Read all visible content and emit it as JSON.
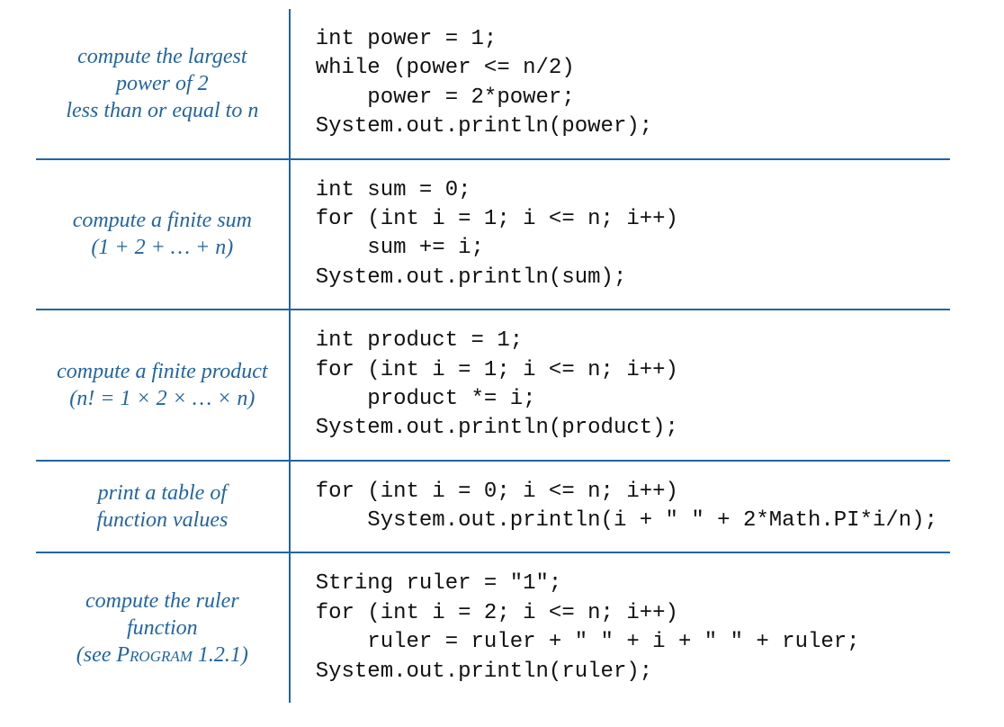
{
  "accent_color": "#2265a0",
  "rows": [
    {
      "desc_html": "compute the largest<br>power of 2<br>less than or equal to n",
      "code": "int power = 1;\nwhile (power <= n/2)\n    power = 2*power;\nSystem.out.println(power);"
    },
    {
      "desc_html": "compute a finite sum<br>(1 + 2 + … + n)",
      "code": "int sum = 0;\nfor (int i = 1; i <= n; i++)\n    sum += i;\nSystem.out.println(sum);"
    },
    {
      "desc_html": "compute a finite product<br>(n! = 1 × 2 ×  …  × n)",
      "code": "int product = 1;\nfor (int i = 1; i <= n; i++)\n    product *= i;\nSystem.out.println(product);"
    },
    {
      "desc_html": "print a table of<br>function values",
      "code": "for (int i = 0; i <= n; i++)\n    System.out.println(i + \" \" + 2*Math.PI*i/n);"
    },
    {
      "desc_html": "compute the ruler function<br>(see <span class=\"smallcaps\">Program</span> 1.2.1)",
      "code": "String ruler = \"1\";\nfor (int i = 2; i <= n; i++)\n    ruler = ruler + \" \" + i + \" \" + ruler;\nSystem.out.println(ruler);"
    }
  ]
}
